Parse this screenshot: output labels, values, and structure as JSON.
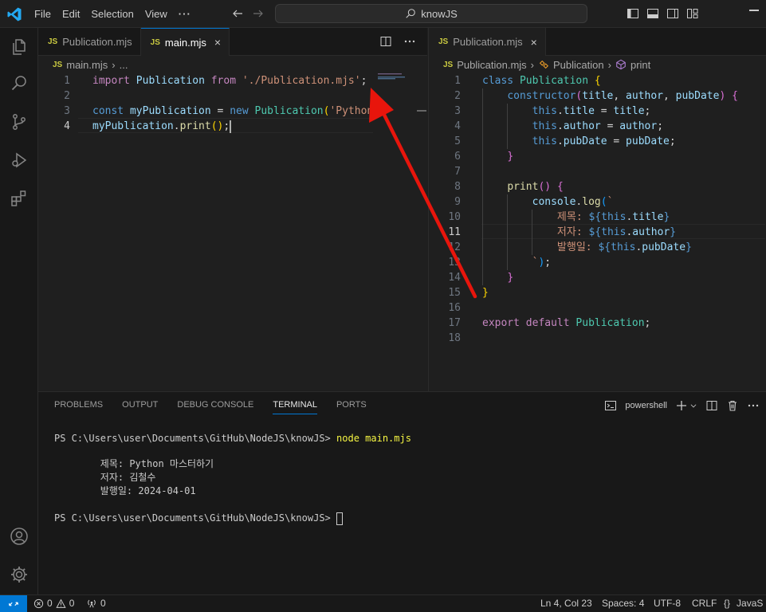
{
  "menu": {
    "file": "File",
    "edit": "Edit",
    "selection": "Selection",
    "view": "View",
    "more": "···"
  },
  "search": {
    "text": "knowJS"
  },
  "left_editor": {
    "tabs": [
      {
        "icon": "JS",
        "label": "Publication.mjs"
      },
      {
        "icon": "JS",
        "label": "main.mjs",
        "close": "×"
      }
    ],
    "breadcrumb": {
      "file": "main.mjs",
      "rest": "..."
    },
    "lines": [
      {
        "n": "1",
        "parts": [
          [
            "kw2",
            "import "
          ],
          [
            "vr",
            "Publication "
          ],
          [
            "kw2",
            "from "
          ],
          [
            "str",
            "'./Publication.mjs'"
          ],
          [
            "pl",
            ";"
          ]
        ]
      },
      {
        "n": "2",
        "parts": []
      },
      {
        "n": "3",
        "parts": [
          [
            "kw",
            "const "
          ],
          [
            "vr",
            "myPublication "
          ],
          [
            "pl",
            "= "
          ],
          [
            "kw",
            "new "
          ],
          [
            "cls",
            "Publication"
          ],
          [
            "br1",
            "("
          ],
          [
            "str",
            "'Python"
          ]
        ]
      },
      {
        "n": "4",
        "parts": [
          [
            "vr",
            "myPublication"
          ],
          [
            "pl",
            "."
          ],
          [
            "fn",
            "print"
          ],
          [
            "br1",
            "()"
          ],
          [
            "pl",
            ";"
          ]
        ]
      }
    ]
  },
  "right_editor": {
    "tabs": [
      {
        "icon": "JS",
        "label": "Publication.mjs",
        "close": "×"
      }
    ],
    "breadcrumb": {
      "file": "Publication.mjs",
      "cls": "Publication",
      "method": "print"
    },
    "lines": [
      {
        "n": "1",
        "parts": [
          [
            "kw",
            "class "
          ],
          [
            "cls",
            "Publication "
          ],
          [
            "br1",
            "{"
          ]
        ]
      },
      {
        "n": "2",
        "parts": [
          [
            "pl",
            "    "
          ],
          [
            "kw",
            "constructor"
          ],
          [
            "br2",
            "("
          ],
          [
            "vr",
            "title"
          ],
          [
            "pl",
            ", "
          ],
          [
            "vr",
            "author"
          ],
          [
            "pl",
            ", "
          ],
          [
            "vr",
            "pubDate"
          ],
          [
            "br2",
            ")"
          ],
          [
            "pl",
            " "
          ],
          [
            "br2",
            "{"
          ]
        ]
      },
      {
        "n": "3",
        "parts": [
          [
            "pl",
            "        "
          ],
          [
            "kw",
            "this"
          ],
          [
            "pl",
            "."
          ],
          [
            "vr",
            "title "
          ],
          [
            "pl",
            "= "
          ],
          [
            "vr",
            "title"
          ],
          [
            "pl",
            ";"
          ]
        ]
      },
      {
        "n": "4",
        "parts": [
          [
            "pl",
            "        "
          ],
          [
            "kw",
            "this"
          ],
          [
            "pl",
            "."
          ],
          [
            "vr",
            "author "
          ],
          [
            "pl",
            "= "
          ],
          [
            "vr",
            "author"
          ],
          [
            "pl",
            ";"
          ]
        ]
      },
      {
        "n": "5",
        "parts": [
          [
            "pl",
            "        "
          ],
          [
            "kw",
            "this"
          ],
          [
            "pl",
            "."
          ],
          [
            "vr",
            "pubDate "
          ],
          [
            "pl",
            "= "
          ],
          [
            "vr",
            "pubDate"
          ],
          [
            "pl",
            ";"
          ]
        ]
      },
      {
        "n": "6",
        "parts": [
          [
            "pl",
            "    "
          ],
          [
            "br2",
            "}"
          ]
        ]
      },
      {
        "n": "7",
        "parts": []
      },
      {
        "n": "8",
        "parts": [
          [
            "pl",
            "    "
          ],
          [
            "fn",
            "print"
          ],
          [
            "br2",
            "()"
          ],
          [
            "pl",
            " "
          ],
          [
            "br2",
            "{"
          ]
        ]
      },
      {
        "n": "9",
        "parts": [
          [
            "pl",
            "        "
          ],
          [
            "vr",
            "console"
          ],
          [
            "pl",
            "."
          ],
          [
            "fn",
            "log"
          ],
          [
            "br3",
            "("
          ],
          [
            "bt",
            "`"
          ]
        ]
      },
      {
        "n": "10",
        "parts": [
          [
            "pl",
            "            "
          ],
          [
            "str",
            "제목: "
          ],
          [
            "kw",
            "${"
          ],
          [
            "kw",
            "this"
          ],
          [
            "pl",
            "."
          ],
          [
            "vr",
            "title"
          ],
          [
            "kw",
            "}"
          ]
        ]
      },
      {
        "n": "11",
        "parts": [
          [
            "pl",
            "            "
          ],
          [
            "str",
            "저자: "
          ],
          [
            "kw",
            "${"
          ],
          [
            "kw",
            "this"
          ],
          [
            "pl",
            "."
          ],
          [
            "vr",
            "author"
          ],
          [
            "kw",
            "}"
          ]
        ]
      },
      {
        "n": "12",
        "parts": [
          [
            "pl",
            "            "
          ],
          [
            "str",
            "발행일: "
          ],
          [
            "kw",
            "${"
          ],
          [
            "kw",
            "this"
          ],
          [
            "pl",
            "."
          ],
          [
            "vr",
            "pubDate"
          ],
          [
            "kw",
            "}"
          ]
        ]
      },
      {
        "n": "13",
        "parts": [
          [
            "pl",
            "        "
          ],
          [
            "bt",
            "`"
          ],
          [
            "br3",
            ")"
          ],
          [
            "pl",
            ";"
          ]
        ]
      },
      {
        "n": "14",
        "parts": [
          [
            "pl",
            "    "
          ],
          [
            "br2",
            "}"
          ]
        ]
      },
      {
        "n": "15",
        "parts": [
          [
            "br1",
            "}"
          ]
        ]
      },
      {
        "n": "16",
        "parts": []
      },
      {
        "n": "17",
        "parts": [
          [
            "kw2",
            "export "
          ],
          [
            "kw2",
            "default "
          ],
          [
            "cls",
            "Publication"
          ],
          [
            "pl",
            ";"
          ]
        ]
      },
      {
        "n": "18",
        "parts": []
      }
    ]
  },
  "panel": {
    "tabs": [
      "PROBLEMS",
      "OUTPUT",
      "DEBUG CONSOLE",
      "TERMINAL",
      "PORTS"
    ],
    "shell": "powershell",
    "terminal": {
      "prompt1": "PS C:\\Users\\user\\Documents\\GitHub\\NodeJS\\knowJS> ",
      "command": "node main.mjs",
      "out1": "        제목: Python 마스터하기",
      "out2": "        저자: 김철수",
      "out3": "        발행일: 2024-04-01",
      "prompt2": "PS C:\\Users\\user\\Documents\\GitHub\\NodeJS\\knowJS> "
    }
  },
  "status": {
    "errors": "0",
    "warnings": "0",
    "ports": "0",
    "position": "Ln 4, Col 23",
    "spaces": "Spaces: 4",
    "encoding": "UTF-8",
    "eol": "CRLF",
    "lang_braces": "{}",
    "language": "JavaS"
  },
  "colors": {
    "accent": "#0078d4",
    "annotation_arrow": "#e8150c"
  }
}
